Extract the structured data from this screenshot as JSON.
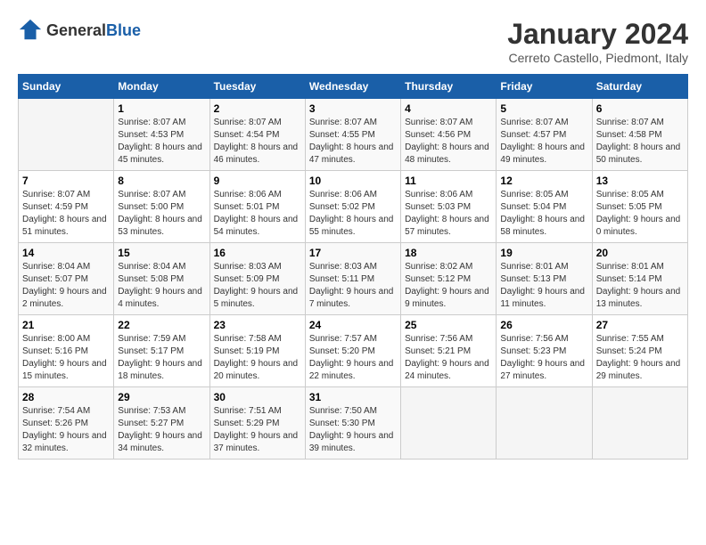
{
  "header": {
    "logo_general": "General",
    "logo_blue": "Blue",
    "title": "January 2024",
    "location": "Cerreto Castello, Piedmont, Italy"
  },
  "days_of_week": [
    "Sunday",
    "Monday",
    "Tuesday",
    "Wednesday",
    "Thursday",
    "Friday",
    "Saturday"
  ],
  "weeks": [
    [
      {
        "day": "",
        "sunrise": "",
        "sunset": "",
        "daylight": "",
        "empty": true
      },
      {
        "day": "1",
        "sunrise": "Sunrise: 8:07 AM",
        "sunset": "Sunset: 4:53 PM",
        "daylight": "Daylight: 8 hours and 45 minutes."
      },
      {
        "day": "2",
        "sunrise": "Sunrise: 8:07 AM",
        "sunset": "Sunset: 4:54 PM",
        "daylight": "Daylight: 8 hours and 46 minutes."
      },
      {
        "day": "3",
        "sunrise": "Sunrise: 8:07 AM",
        "sunset": "Sunset: 4:55 PM",
        "daylight": "Daylight: 8 hours and 47 minutes."
      },
      {
        "day": "4",
        "sunrise": "Sunrise: 8:07 AM",
        "sunset": "Sunset: 4:56 PM",
        "daylight": "Daylight: 8 hours and 48 minutes."
      },
      {
        "day": "5",
        "sunrise": "Sunrise: 8:07 AM",
        "sunset": "Sunset: 4:57 PM",
        "daylight": "Daylight: 8 hours and 49 minutes."
      },
      {
        "day": "6",
        "sunrise": "Sunrise: 8:07 AM",
        "sunset": "Sunset: 4:58 PM",
        "daylight": "Daylight: 8 hours and 50 minutes."
      }
    ],
    [
      {
        "day": "7",
        "sunrise": "Sunrise: 8:07 AM",
        "sunset": "Sunset: 4:59 PM",
        "daylight": "Daylight: 8 hours and 51 minutes."
      },
      {
        "day": "8",
        "sunrise": "Sunrise: 8:07 AM",
        "sunset": "Sunset: 5:00 PM",
        "daylight": "Daylight: 8 hours and 53 minutes."
      },
      {
        "day": "9",
        "sunrise": "Sunrise: 8:06 AM",
        "sunset": "Sunset: 5:01 PM",
        "daylight": "Daylight: 8 hours and 54 minutes."
      },
      {
        "day": "10",
        "sunrise": "Sunrise: 8:06 AM",
        "sunset": "Sunset: 5:02 PM",
        "daylight": "Daylight: 8 hours and 55 minutes."
      },
      {
        "day": "11",
        "sunrise": "Sunrise: 8:06 AM",
        "sunset": "Sunset: 5:03 PM",
        "daylight": "Daylight: 8 hours and 57 minutes."
      },
      {
        "day": "12",
        "sunrise": "Sunrise: 8:05 AM",
        "sunset": "Sunset: 5:04 PM",
        "daylight": "Daylight: 8 hours and 58 minutes."
      },
      {
        "day": "13",
        "sunrise": "Sunrise: 8:05 AM",
        "sunset": "Sunset: 5:05 PM",
        "daylight": "Daylight: 9 hours and 0 minutes."
      }
    ],
    [
      {
        "day": "14",
        "sunrise": "Sunrise: 8:04 AM",
        "sunset": "Sunset: 5:07 PM",
        "daylight": "Daylight: 9 hours and 2 minutes."
      },
      {
        "day": "15",
        "sunrise": "Sunrise: 8:04 AM",
        "sunset": "Sunset: 5:08 PM",
        "daylight": "Daylight: 9 hours and 4 minutes."
      },
      {
        "day": "16",
        "sunrise": "Sunrise: 8:03 AM",
        "sunset": "Sunset: 5:09 PM",
        "daylight": "Daylight: 9 hours and 5 minutes."
      },
      {
        "day": "17",
        "sunrise": "Sunrise: 8:03 AM",
        "sunset": "Sunset: 5:11 PM",
        "daylight": "Daylight: 9 hours and 7 minutes."
      },
      {
        "day": "18",
        "sunrise": "Sunrise: 8:02 AM",
        "sunset": "Sunset: 5:12 PM",
        "daylight": "Daylight: 9 hours and 9 minutes."
      },
      {
        "day": "19",
        "sunrise": "Sunrise: 8:01 AM",
        "sunset": "Sunset: 5:13 PM",
        "daylight": "Daylight: 9 hours and 11 minutes."
      },
      {
        "day": "20",
        "sunrise": "Sunrise: 8:01 AM",
        "sunset": "Sunset: 5:14 PM",
        "daylight": "Daylight: 9 hours and 13 minutes."
      }
    ],
    [
      {
        "day": "21",
        "sunrise": "Sunrise: 8:00 AM",
        "sunset": "Sunset: 5:16 PM",
        "daylight": "Daylight: 9 hours and 15 minutes."
      },
      {
        "day": "22",
        "sunrise": "Sunrise: 7:59 AM",
        "sunset": "Sunset: 5:17 PM",
        "daylight": "Daylight: 9 hours and 18 minutes."
      },
      {
        "day": "23",
        "sunrise": "Sunrise: 7:58 AM",
        "sunset": "Sunset: 5:19 PM",
        "daylight": "Daylight: 9 hours and 20 minutes."
      },
      {
        "day": "24",
        "sunrise": "Sunrise: 7:57 AM",
        "sunset": "Sunset: 5:20 PM",
        "daylight": "Daylight: 9 hours and 22 minutes."
      },
      {
        "day": "25",
        "sunrise": "Sunrise: 7:56 AM",
        "sunset": "Sunset: 5:21 PM",
        "daylight": "Daylight: 9 hours and 24 minutes."
      },
      {
        "day": "26",
        "sunrise": "Sunrise: 7:56 AM",
        "sunset": "Sunset: 5:23 PM",
        "daylight": "Daylight: 9 hours and 27 minutes."
      },
      {
        "day": "27",
        "sunrise": "Sunrise: 7:55 AM",
        "sunset": "Sunset: 5:24 PM",
        "daylight": "Daylight: 9 hours and 29 minutes."
      }
    ],
    [
      {
        "day": "28",
        "sunrise": "Sunrise: 7:54 AM",
        "sunset": "Sunset: 5:26 PM",
        "daylight": "Daylight: 9 hours and 32 minutes."
      },
      {
        "day": "29",
        "sunrise": "Sunrise: 7:53 AM",
        "sunset": "Sunset: 5:27 PM",
        "daylight": "Daylight: 9 hours and 34 minutes."
      },
      {
        "day": "30",
        "sunrise": "Sunrise: 7:51 AM",
        "sunset": "Sunset: 5:29 PM",
        "daylight": "Daylight: 9 hours and 37 minutes."
      },
      {
        "day": "31",
        "sunrise": "Sunrise: 7:50 AM",
        "sunset": "Sunset: 5:30 PM",
        "daylight": "Daylight: 9 hours and 39 minutes."
      },
      {
        "day": "",
        "sunrise": "",
        "sunset": "",
        "daylight": "",
        "empty": true
      },
      {
        "day": "",
        "sunrise": "",
        "sunset": "",
        "daylight": "",
        "empty": true
      },
      {
        "day": "",
        "sunrise": "",
        "sunset": "",
        "daylight": "",
        "empty": true
      }
    ]
  ]
}
